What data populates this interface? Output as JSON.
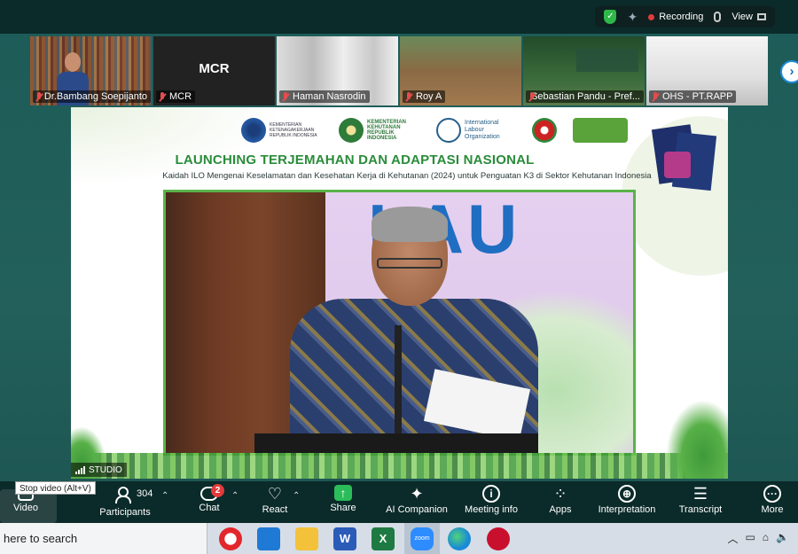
{
  "zoom": {
    "recording_label": "Recording",
    "view_label": "View"
  },
  "participants": [
    {
      "name": "Dr.Bambang Soepijanto"
    },
    {
      "name": "MCR",
      "tile_text": "MCR"
    },
    {
      "name": "Haman Nasrodin"
    },
    {
      "name": "Roy A"
    },
    {
      "name": "Sebastian Pandu - Pref..."
    },
    {
      "name": "OHS - PT.RAPP"
    }
  ],
  "slide": {
    "title": "LAUNCHING TERJEMAHAN DAN ADAPTASI NASIONAL",
    "subtitle": "Kaidah ILO Mengenai Keselamatan dan Kesehatan Kerja di Kehutanan (2024) untuk Penguatan K3 di Sektor Kehutanan Indonesia",
    "logos": [
      "KEMENTERIAN KETENAGAKERJAAN REPUBLIK INDONESIA",
      "KEMENTERIAN KEHUTANAN REPUBLIK INDONESIA",
      "International Labour Organization",
      "",
      ""
    ],
    "screen_text": "LAU",
    "studio_label": "STUDIO"
  },
  "toolbar": {
    "tooltip": "Stop video (Alt+V)",
    "video": "Video",
    "participants": "Participants",
    "participant_count": "304",
    "chat": "Chat",
    "chat_badge": "2",
    "react": "React",
    "share": "Share",
    "ai_companion": "AI Companion",
    "meeting_info": "Meeting info",
    "apps": "Apps",
    "interpretation": "Interpretation",
    "transcript": "Transcript",
    "more": "More"
  },
  "taskbar": {
    "search_text": "here to search",
    "zoom_label": "zoom"
  }
}
